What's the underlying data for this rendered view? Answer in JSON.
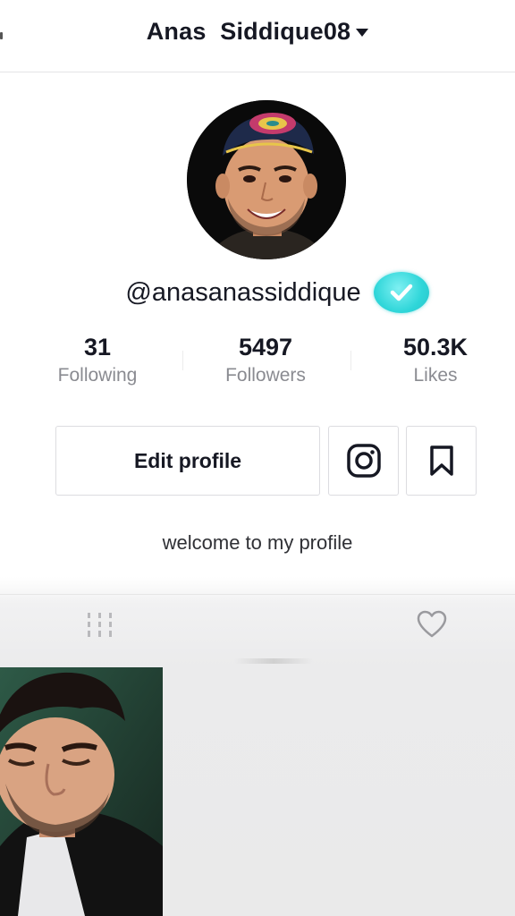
{
  "header": {
    "account_name": "Anas  Siddique08",
    "caret_icon": "caret-down-icon"
  },
  "profile": {
    "avatar_icon": "avatar-photo",
    "handle": "@anasanassiddique",
    "verified_icon": "verified-check-icon",
    "verified_color": "#2fd6d9",
    "stats": [
      {
        "value": "31",
        "label": "Following"
      },
      {
        "value": "5497",
        "label": "Followers"
      },
      {
        "value": "50.3K",
        "label": "Likes"
      }
    ],
    "edit_button_label": "Edit profile",
    "instagram_icon": "instagram-icon",
    "bookmark_icon": "bookmark-icon",
    "bio": "welcome to my profile"
  },
  "tabs": {
    "videos_icon": "grid-videos-icon",
    "liked_icon": "heart-icon"
  },
  "videos": [
    {
      "thumbnail": "video-thumbnail-person"
    }
  ]
}
